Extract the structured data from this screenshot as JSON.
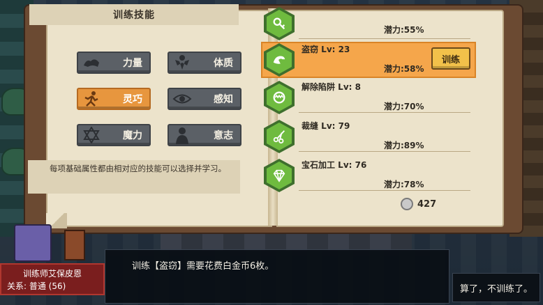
{
  "left_page": {
    "title": "训练技能",
    "attributes": [
      {
        "label": "力量",
        "icon": "strength-icon",
        "active": false
      },
      {
        "label": "体质",
        "icon": "constitution-icon",
        "active": false
      },
      {
        "label": "灵巧",
        "icon": "agility-icon",
        "active": true
      },
      {
        "label": "感知",
        "icon": "perception-icon",
        "active": false
      },
      {
        "label": "魔力",
        "icon": "magic-icon",
        "active": false
      },
      {
        "label": "意志",
        "icon": "willpower-icon",
        "active": false
      }
    ],
    "description": "每项基础属性都由相对应的技能可以选择并学习。"
  },
  "right_page": {
    "skills": [
      {
        "name": "",
        "potential": "潜力:55%",
        "icon": "key-icon"
      },
      {
        "name": "盗窃 Lv: 23",
        "potential": "潜力:58%",
        "icon": "theft-icon",
        "selected": true
      },
      {
        "name": "解除陷阱 Lv: 8",
        "potential": "潜力:70%",
        "icon": "trap-icon"
      },
      {
        "name": "裁缝 Lv: 79",
        "potential": "潜力:89%",
        "icon": "tailoring-icon"
      },
      {
        "name": "宝石加工 Lv: 76",
        "potential": "潜力:78%",
        "icon": "gem-icon"
      }
    ],
    "train_label": "训练",
    "coins": "427"
  },
  "dialog": {
    "message": "训练【盗窃】需要花费白金币6枚。",
    "npc_name": "训练师艾保皮恩",
    "npc_relation": "关系: 普通 (56)",
    "reply": "算了，不训练了。"
  },
  "colors": {
    "accent": "#e7963e",
    "page": "#ece3cb",
    "button_gray": "#5b6066",
    "hex_green": "#6fbb3f"
  }
}
